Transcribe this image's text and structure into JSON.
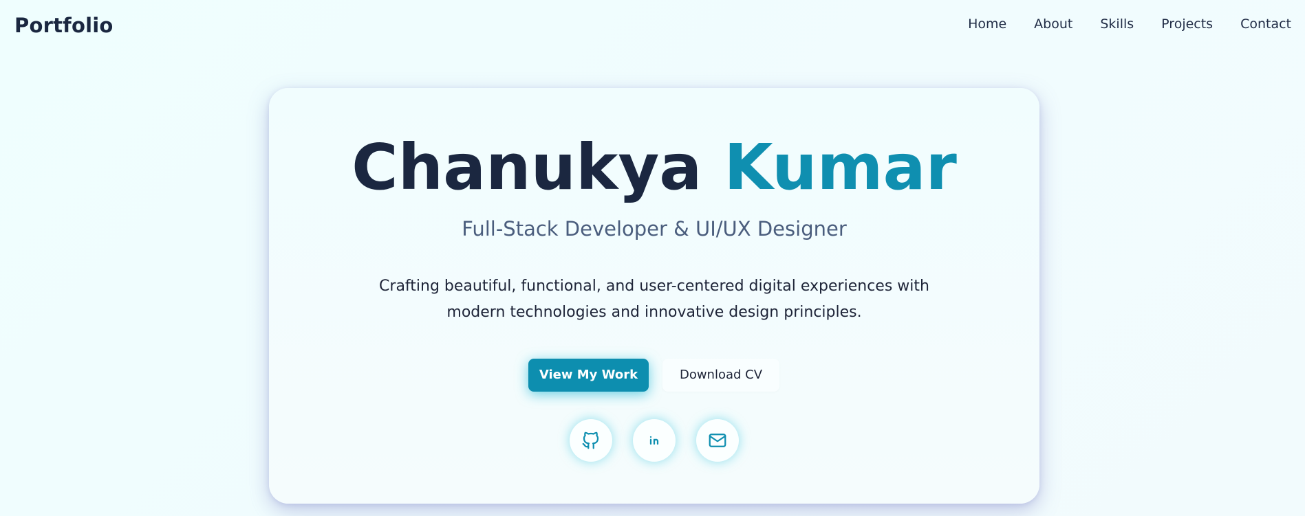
{
  "header": {
    "brand": "Portfolio",
    "nav": [
      {
        "label": "Home"
      },
      {
        "label": "About"
      },
      {
        "label": "Skills"
      },
      {
        "label": "Projects"
      },
      {
        "label": "Contact"
      }
    ]
  },
  "hero": {
    "first_name": "Chanukya",
    "last_name": "Kumar",
    "subtitle": "Full-Stack Developer & UI/UX Designer",
    "description": "Crafting beautiful, functional, and user-centered digital experiences with modern technologies and innovative design principles.",
    "primary_button": "View My Work",
    "secondary_button": "Download CV",
    "social": [
      {
        "icon": "github-icon"
      },
      {
        "icon": "linkedin-icon"
      },
      {
        "icon": "mail-icon"
      }
    ]
  },
  "colors": {
    "accent": "#0f8fb0",
    "text_dark": "#1b2740",
    "subtitle": "#4a5d7d"
  }
}
